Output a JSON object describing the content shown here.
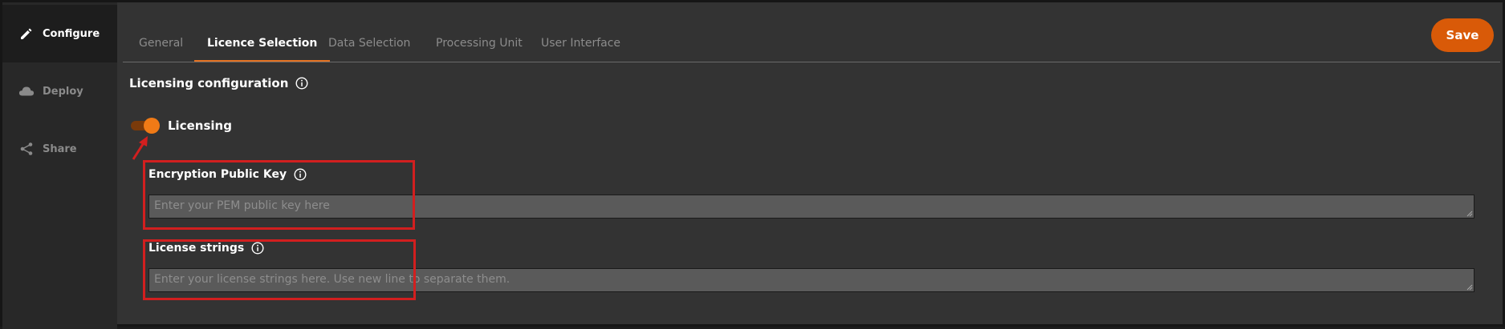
{
  "sidebar": {
    "items": [
      {
        "label": "Configure",
        "icon": "pencil-icon",
        "active": true
      },
      {
        "label": "Deploy",
        "icon": "cloud-icon",
        "active": false
      },
      {
        "label": "Share",
        "icon": "share-icon",
        "active": false
      }
    ]
  },
  "tabs": [
    {
      "label": "General",
      "active": false
    },
    {
      "label": "Licence Selection",
      "active": true
    },
    {
      "label": "Data Selection",
      "active": false
    },
    {
      "label": "Processing Unit",
      "active": false
    },
    {
      "label": "User Interface",
      "active": false
    }
  ],
  "toolbar": {
    "save_label": "Save"
  },
  "section": {
    "title": "Licensing configuration"
  },
  "licensing_toggle": {
    "label": "Licensing",
    "on": true
  },
  "fields": {
    "public_key": {
      "label": "Encryption Public Key",
      "value": "",
      "placeholder": "Enter your PEM public key here"
    },
    "license_strings": {
      "label": "License strings",
      "value": "",
      "placeholder": "Enter your license strings here. Use new line to separate them."
    }
  },
  "colors": {
    "accent": "#e37222",
    "save_button": "#d95a08",
    "highlight": "#d21f1f",
    "background": "#333333",
    "sidebar": "#282828"
  }
}
